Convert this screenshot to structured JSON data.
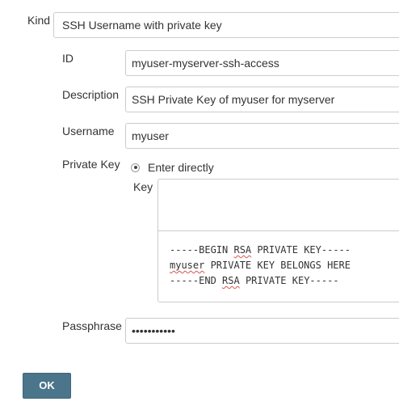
{
  "form": {
    "kind": {
      "label": "Kind",
      "value": "SSH Username with private key"
    },
    "id": {
      "label": "ID",
      "value": "myuser-myserver-ssh-access"
    },
    "description": {
      "label": "Description",
      "value": "SSH Private Key of myuser for myserver"
    },
    "username": {
      "label": "Username",
      "value": "myuser"
    },
    "private_key": {
      "label": "Private Key",
      "option_label": "Enter directly",
      "key_label": "Key",
      "lines": {
        "begin_prefix": "-----BEGIN ",
        "begin_rsa": "RSA",
        "begin_suffix": " PRIVATE KEY-----",
        "body_user": "myuser",
        "body_suffix": " PRIVATE KEY BELONGS HERE",
        "end_prefix": "-----END ",
        "end_rsa": "RSA",
        "end_suffix": " PRIVATE KEY-----"
      }
    },
    "passphrase": {
      "label": "Passphrase",
      "masked_value": "•••••••••••"
    },
    "ok_label": "OK"
  }
}
